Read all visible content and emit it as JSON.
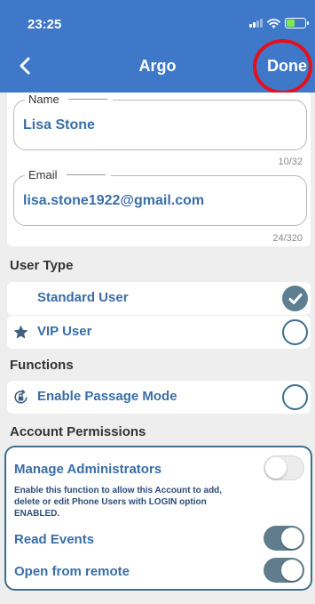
{
  "status_bar": {
    "time": "23:25",
    "battery_color": "#7bea4f"
  },
  "header": {
    "title": "Argo",
    "done_label": "Done",
    "back_icon": "chevron-left-icon",
    "bg_color": "#3f78c8"
  },
  "name_field": {
    "label": "Name",
    "value": "Lisa Stone",
    "counter": "10/32"
  },
  "email_field": {
    "label": "Email",
    "value": "lisa.stone1922@gmail.com",
    "counter": "24/320"
  },
  "user_type": {
    "heading": "User Type",
    "options": [
      {
        "label": "Standard User",
        "selected": true
      },
      {
        "label": "VIP User",
        "icon": "star-icon",
        "selected": false
      }
    ]
  },
  "functions": {
    "heading": "Functions",
    "items": [
      {
        "label": "Enable Passage Mode",
        "icon": "passage-lock-icon",
        "selected": false
      }
    ]
  },
  "account_permissions": {
    "heading": "Account Permissions",
    "items": [
      {
        "label": "Manage Administrators",
        "enabled": false,
        "description": "Enable this function to allow this Account to add, delete or edit Phone Users with LOGIN option ENABLED."
      },
      {
        "label": "Read Events",
        "enabled": true
      },
      {
        "label": "Open from remote",
        "enabled": true
      }
    ]
  }
}
